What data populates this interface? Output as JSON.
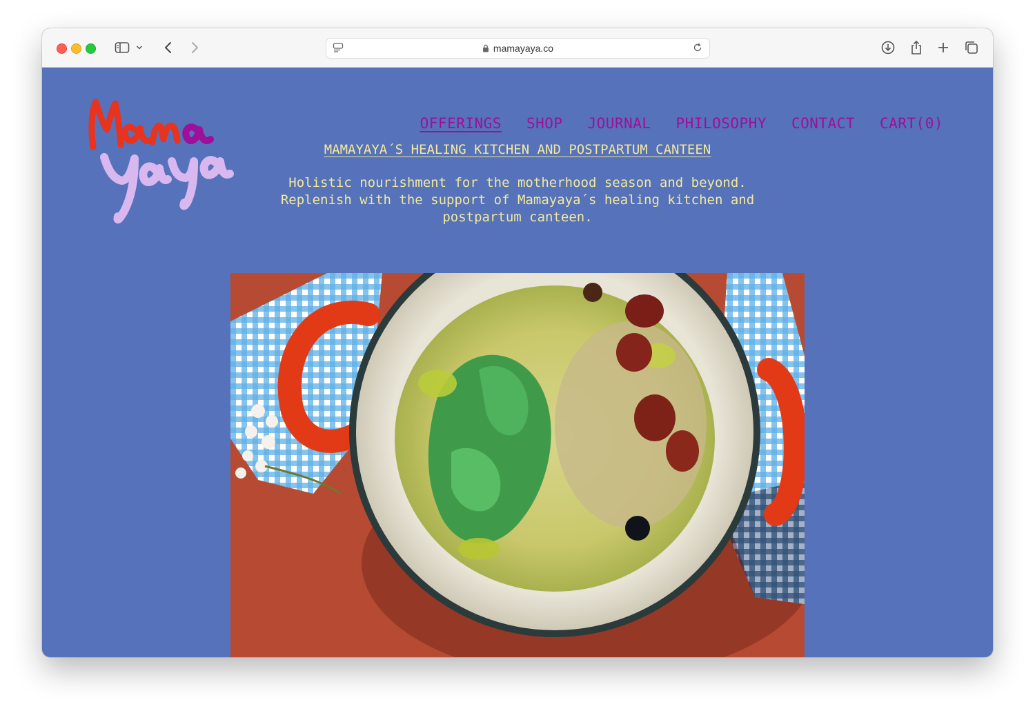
{
  "browser": {
    "url": "mamayaya.co"
  },
  "site": {
    "logo_text": "Mama yaya",
    "nav": [
      {
        "label": "OFFERINGS",
        "active": true
      },
      {
        "label": "SHOP",
        "active": false
      },
      {
        "label": "JOURNAL",
        "active": false
      },
      {
        "label": "PHILOSOPHY",
        "active": false
      },
      {
        "label": "CONTACT",
        "active": false
      },
      {
        "label": "CART(0)",
        "active": false
      }
    ],
    "headline": "MAMAYAYA´S HEALING KITCHEN AND POSTPARTUM CANTEEN",
    "tagline_lines": [
      "Holistic nourishment for the motherhood season and beyond.",
      "Replenish with the support of Mamayaya´s healing kitchen and",
      "postpartum canteen."
    ]
  },
  "colors": {
    "page_background": "#5572bb",
    "nav_text": "#9e0f9a",
    "headline_text": "#f3e89a",
    "logo_red": "#e8331f",
    "logo_purple": "#9e0f9a",
    "logo_lilac": "#d9b8f0"
  }
}
